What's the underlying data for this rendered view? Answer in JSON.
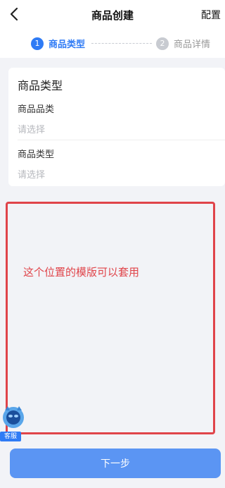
{
  "header": {
    "title": "商品创建",
    "config_label": "配置"
  },
  "steps": [
    {
      "number": "1",
      "label": "商品类型",
      "active": true
    },
    {
      "number": "2",
      "label": "商品详情",
      "active": false
    }
  ],
  "card": {
    "title": "商品类型",
    "fields": [
      {
        "label": "商品品类",
        "placeholder": "请选择"
      },
      {
        "label": "商品类型",
        "placeholder": "请选择"
      }
    ]
  },
  "template_area": {
    "annotation": "这个位置的模版可以套用",
    "border_color": "#e0444a"
  },
  "service": {
    "label": "客服"
  },
  "footer": {
    "next_label": "下一步"
  },
  "colors": {
    "accent": "#2f7bf5",
    "button": "#5b95f3",
    "background": "#f2f3f7"
  }
}
